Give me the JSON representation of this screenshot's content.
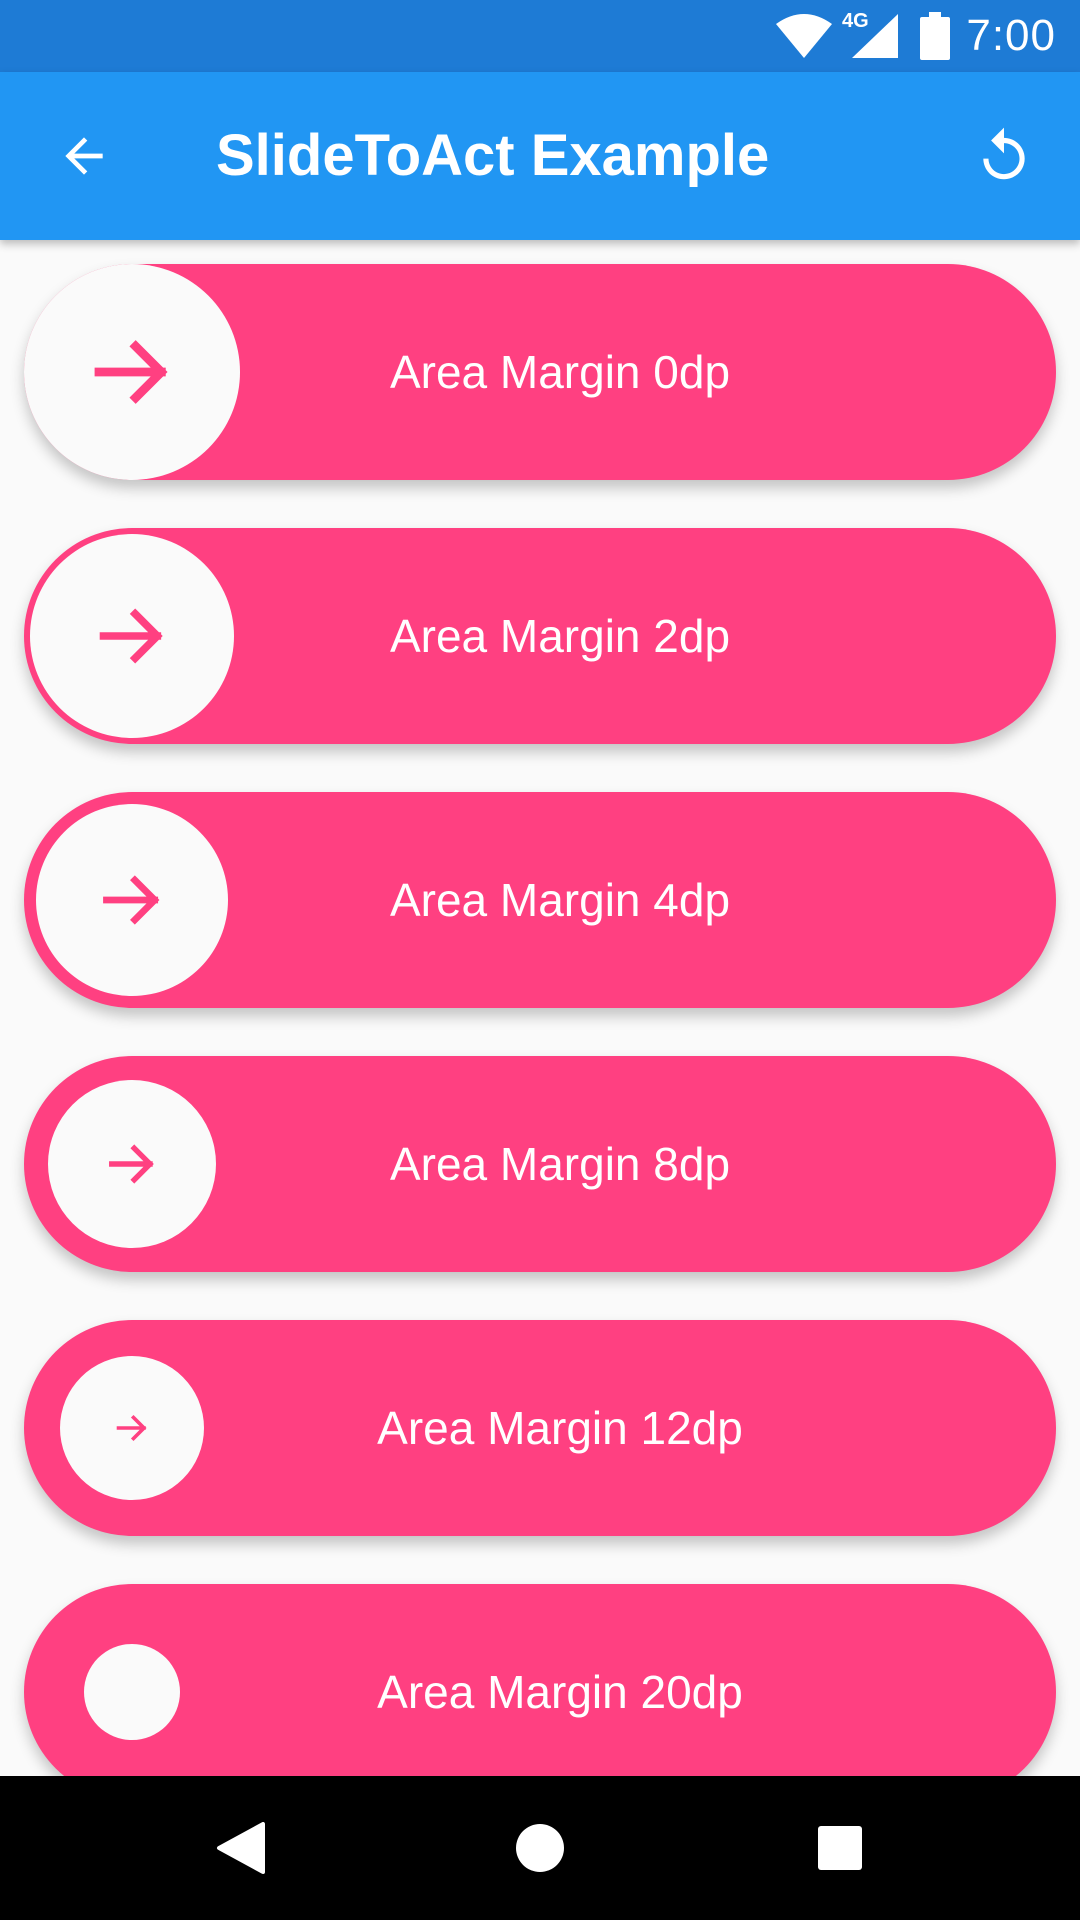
{
  "status_bar": {
    "time": "7:00",
    "network_label": "4G",
    "icons": [
      "wifi-icon",
      "cell-signal-icon",
      "battery-icon"
    ]
  },
  "app_bar": {
    "title": "SlideToAct Example",
    "back_icon": "arrow-back-icon",
    "action_icon": "reset-icon"
  },
  "sliders": [
    {
      "label": "Area Margin 0dp"
    },
    {
      "label": "Area Margin 2dp"
    },
    {
      "label": "Area Margin 4dp"
    },
    {
      "label": "Area Margin 8dp"
    },
    {
      "label": "Area Margin 12dp"
    },
    {
      "label": "Area Margin 20dp"
    }
  ],
  "nav_bar": {
    "icons": [
      "nav-back-icon",
      "nav-home-icon",
      "nav-recents-icon"
    ]
  },
  "colors": {
    "status_bar": "#1E7BD5",
    "app_bar": "#2196F3",
    "slider": "#FF4081",
    "knob": "#FAFAFA",
    "background": "#FAFAFA"
  }
}
